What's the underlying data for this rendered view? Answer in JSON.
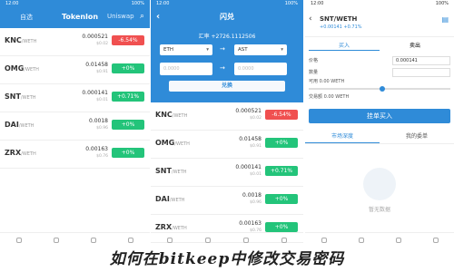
{
  "caption": "如何在bitkeep中修改交易密码",
  "panel1": {
    "status_time": "12:00",
    "status_right": "100%",
    "tabs": [
      "自选",
      "Tokenlon",
      "Uniswap"
    ],
    "rows": [
      {
        "symbol": "KNC",
        "quote": "/WETH",
        "price": "0.000521",
        "sub": "$0.02",
        "change": "-6.54%",
        "dir": "down"
      },
      {
        "symbol": "OMG",
        "quote": "/WETH",
        "price": "0.01458",
        "sub": "$0.91",
        "change": "+0%",
        "dir": "up"
      },
      {
        "symbol": "SNT",
        "quote": "/WETH",
        "price": "0.000141",
        "sub": "$0.01",
        "change": "+0.71%",
        "dir": "up"
      },
      {
        "symbol": "DAI",
        "quote": "/WETH",
        "price": "0.0018",
        "sub": "$0.96",
        "change": "+0%",
        "dir": "up"
      },
      {
        "symbol": "ZRX",
        "quote": "/WETH",
        "price": "0.00163",
        "sub": "$0.76",
        "change": "+0%",
        "dir": "up"
      }
    ]
  },
  "panel2": {
    "title": "闪兑",
    "balance": "汇率 +2726.1112506",
    "from_token": "ETH",
    "to_token": "AST",
    "from_placeholder": "0.0000",
    "to_placeholder": "0.0000",
    "swap_label": "兑换",
    "rows": [
      {
        "symbol": "KNC",
        "quote": "/WETH",
        "price": "0.000521",
        "sub": "$0.02",
        "change": "-6.54%",
        "dir": "down"
      },
      {
        "symbol": "OMG",
        "quote": "/WETH",
        "price": "0.01458",
        "sub": "$0.91",
        "change": "+0%",
        "dir": "up"
      },
      {
        "symbol": "SNT",
        "quote": "/WETH",
        "price": "0.000141",
        "sub": "$0.01",
        "change": "+0.71%",
        "dir": "up"
      },
      {
        "symbol": "DAI",
        "quote": "/WETH",
        "price": "0.0018",
        "sub": "$0.96",
        "change": "+0%",
        "dir": "up"
      },
      {
        "symbol": "ZRX",
        "quote": "/WETH",
        "price": "0.00163",
        "sub": "$0.76",
        "change": "+0%",
        "dir": "up"
      }
    ]
  },
  "panel3": {
    "title": "SNT/WETH",
    "change": "+0.00141 +0.71%",
    "seg_buy": "买入",
    "seg_sell": "卖出",
    "price_label": "价格",
    "price_value": "0.000141",
    "amount_label": "数量",
    "avail_label": "可用 0.00 WETH",
    "total_label": "交易额 0.00 WETH",
    "buy_button": "挂单买入",
    "tab_depth": "市场深度",
    "tab_orders": "我的委单",
    "empty_text": "暂无数据"
  },
  "colors": {
    "brand": "#2f8bd8",
    "up": "#23c47a",
    "down": "#f05050"
  }
}
